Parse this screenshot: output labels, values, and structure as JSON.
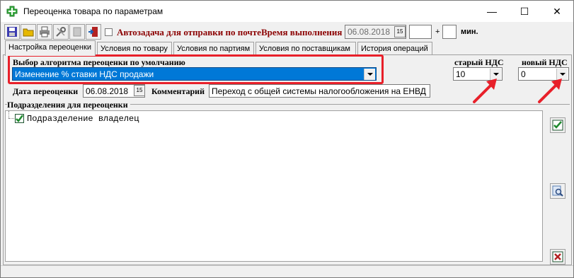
{
  "window": {
    "title": "Переоценка товара по параметрам",
    "minimize": "—",
    "maximize": "☐",
    "close": "✕"
  },
  "toolbar": {
    "autotask_label": "Автозадача для отправки по почте",
    "time_label": "Время выполнения",
    "date_value": "06.08.2018",
    "calendar_label": "15",
    "plus": "+",
    "minutes_label": "мин."
  },
  "tabs": [
    {
      "label": "Настройка переоценки"
    },
    {
      "label": "Условия по товару"
    },
    {
      "label": "Условия по партиям"
    },
    {
      "label": "Условия по поставщикам"
    },
    {
      "label": "История операций"
    }
  ],
  "algorithm": {
    "label": "Выбор алгоритма переоценки по умолчанию",
    "value": "Изменение % ставки НДС продажи"
  },
  "vat": {
    "old_label": "старый НДС",
    "old_value": "10",
    "new_label": "новый НДС",
    "new_value": "0"
  },
  "revaluation": {
    "date_label": "Дата переоценки",
    "date_value": "06.08.2018",
    "calendar_label": "15",
    "comment_label": "Комментарий",
    "comment_value": "Переход с общей системы налогообложения на ЕНВД"
  },
  "departments": {
    "label": "Подразделения для переоценки",
    "items": [
      {
        "label": "Подразделение владелец",
        "checked": true
      }
    ]
  },
  "colors": {
    "highlight_border": "#e8202a",
    "selection": "#0078d7",
    "arrow": "#e8202a",
    "label_dark_red": "#8b0000"
  }
}
